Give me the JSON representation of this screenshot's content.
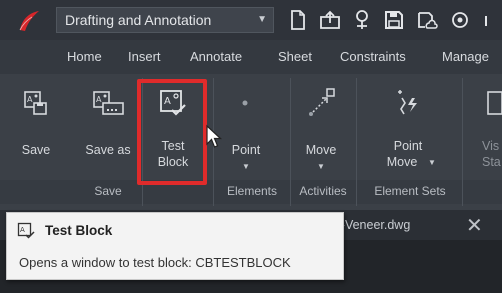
{
  "titlebar": {
    "workspace_name": "Drafting and Annotation",
    "quick_access_icons": [
      "new-file-icon",
      "open-folder-icon",
      "map-pin-icon",
      "save-icon",
      "save-cloud-icon",
      "share-icon"
    ]
  },
  "tabs": [
    "Home",
    "Insert",
    "Annotate",
    "Sheet",
    "Constraints",
    "Manage"
  ],
  "ribbon": {
    "buttons": [
      {
        "label": "Save",
        "icon": "block-save-icon"
      },
      {
        "label": "Save as",
        "icon": "block-save-as-icon"
      },
      {
        "label_line1": "Test",
        "label_line2": "Block",
        "icon": "test-block-icon"
      },
      {
        "label": "Point",
        "icon": "point-icon"
      },
      {
        "label": "Move",
        "icon": "move-point-icon"
      },
      {
        "label_line1": "Point",
        "label_line2": "Move",
        "icon": "point-move-icon"
      },
      {
        "label_line1": "Vis",
        "label_line2": "Sta",
        "icon": "visibility-states-icon"
      }
    ],
    "groups": [
      "Save",
      "Elements",
      "Activities",
      "Element Sets"
    ]
  },
  "document_tab": {
    "name": "l-Veneer.dwg",
    "close_symbol": "✕"
  },
  "tooltip": {
    "title": "Test Block",
    "description": "Opens a window to test block: CBTESTBLOCK",
    "icon": "test-block-icon"
  },
  "colors": {
    "highlight": "#e02b2b",
    "app_logo": "#d8262a"
  }
}
